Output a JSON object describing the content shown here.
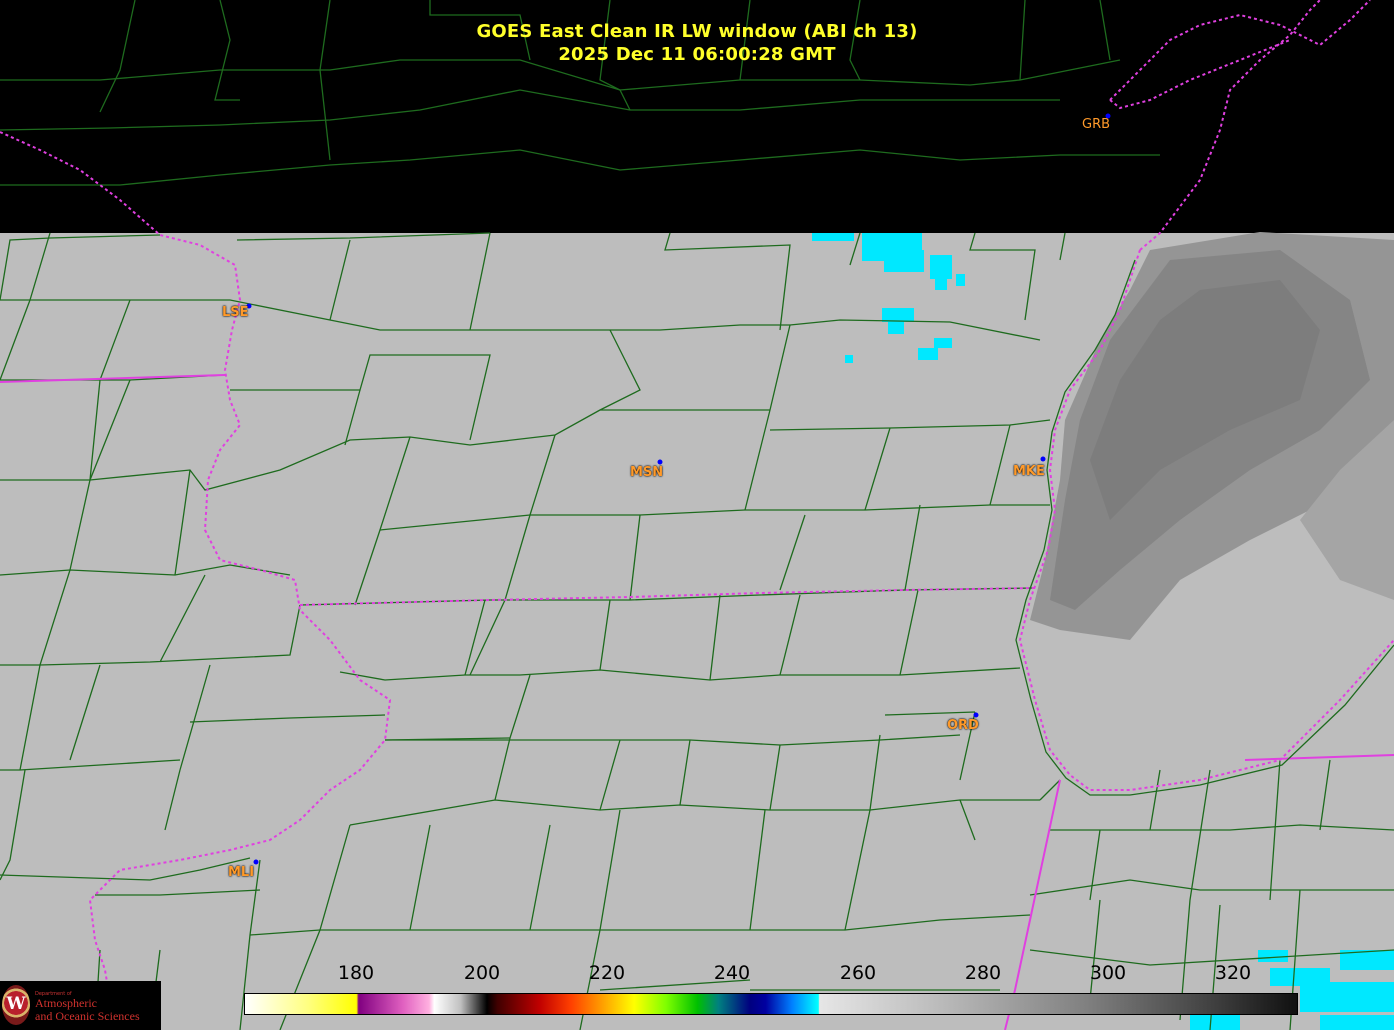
{
  "title": {
    "line1": "GOES East Clean IR LW window (ABI ch 13)",
    "line2": "2025 Dec 11  06:00:28 GMT",
    "color": "#ffff2a"
  },
  "stations": [
    {
      "id": "LSE",
      "label": "LSE"
    },
    {
      "id": "MSN",
      "label": "MSN"
    },
    {
      "id": "MKE",
      "label": "MKE"
    },
    {
      "id": "ORD",
      "label": "ORD"
    },
    {
      "id": "MLI",
      "label": "MLI"
    },
    {
      "id": "GRB",
      "label": "GRB"
    }
  ],
  "colorbar": {
    "ticks": [
      "180",
      "200",
      "220",
      "240",
      "260",
      "280",
      "300",
      "320"
    ]
  },
  "logo": {
    "dept": "Department of",
    "name_line1": "Atmospheric",
    "name_line2": "and Oceanic Sciences",
    "emblem": "W"
  },
  "colors": {
    "county_lines": "#1e6b1e",
    "state_lines": "#e040e0",
    "ground_gray": "#bdbdbd",
    "cloud_gray": "#8a8a8a",
    "cold_cyan": "#00e5ff",
    "station_label": "#ff9a2a",
    "station_dot": "#0000ff"
  }
}
